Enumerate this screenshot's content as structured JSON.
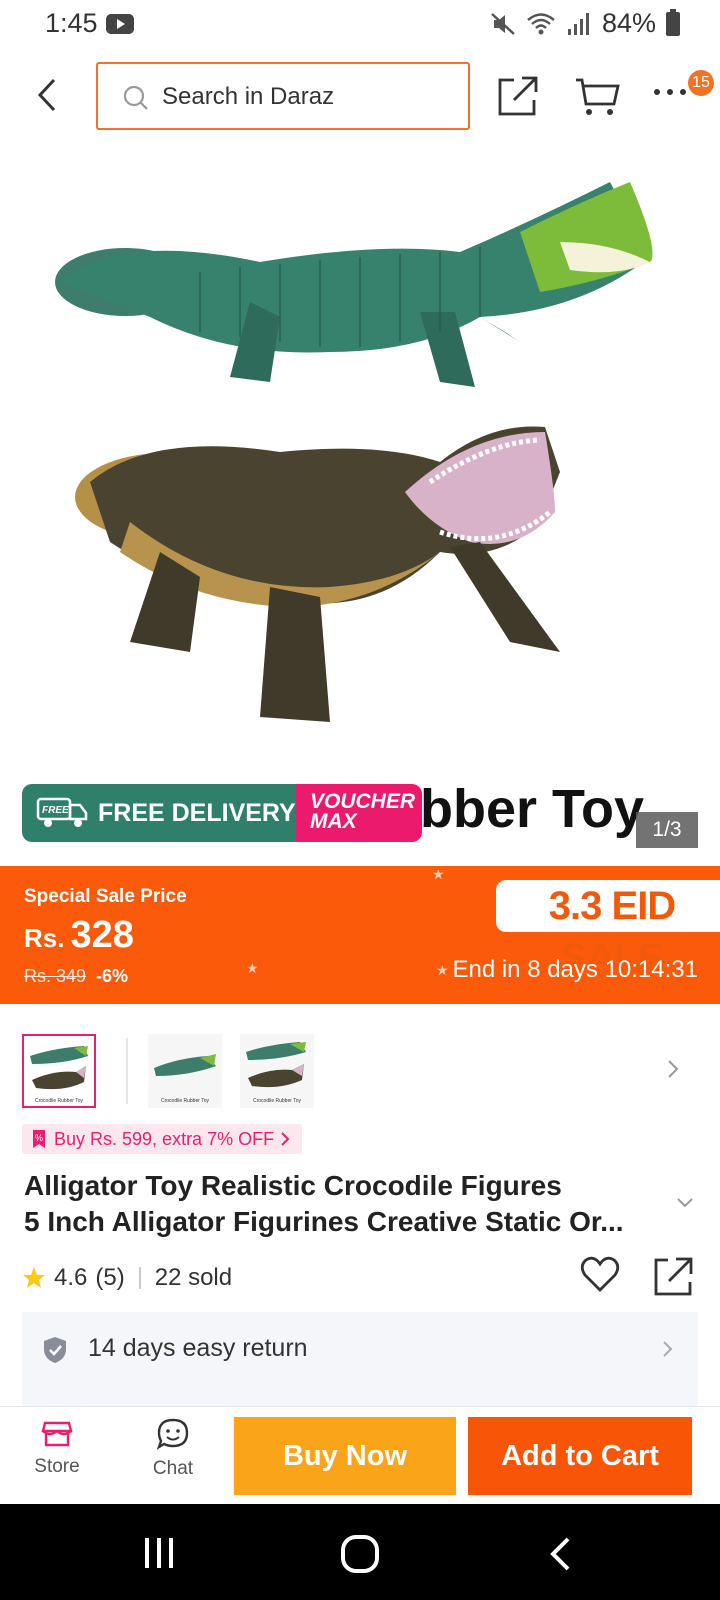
{
  "status_bar": {
    "time": "1:45",
    "battery": "84%"
  },
  "header": {
    "search_placeholder": "Search in Daraz",
    "cart_badge": "15"
  },
  "image": {
    "caption_text": "bber Toy",
    "counter": "1/3",
    "promo_free_badge": "FREE",
    "promo_free_delivery": "FREE DELIVERY",
    "promo_voucher": "VOUCHER",
    "promo_voucher_max": "MAX"
  },
  "sale": {
    "label": "Special Sale Price",
    "currency": "Rs.",
    "price": "328",
    "old_price": "Rs. 349",
    "discount": "-6%",
    "tag": "3.3 EID SALE",
    "countdown": "End in 8 days 10:14:31"
  },
  "thumbnails": {
    "caption": "Crocodile Rubber Toy"
  },
  "promo_chip": "Buy Rs. 599, extra 7% OFF",
  "product": {
    "title_line1": "Alligator Toy Realistic Crocodile Figures",
    "title_line2": "5 Inch Alligator Figurines Creative Static Or..."
  },
  "rating": {
    "score": "4.6",
    "count": "(5)",
    "sold": "22 sold"
  },
  "return_policy": "14 days easy return",
  "actions": {
    "store": "Store",
    "chat": "Chat",
    "buy_now": "Buy Now",
    "add_to_cart": "Add to Cart"
  },
  "colors": {
    "accent": "#f57224",
    "sale_bg": "#fa5a0a",
    "buy_now": "#faa41a",
    "add_to_cart": "#f85606",
    "pink": "#e61f6e",
    "delivery_green": "#2f7f6a"
  }
}
